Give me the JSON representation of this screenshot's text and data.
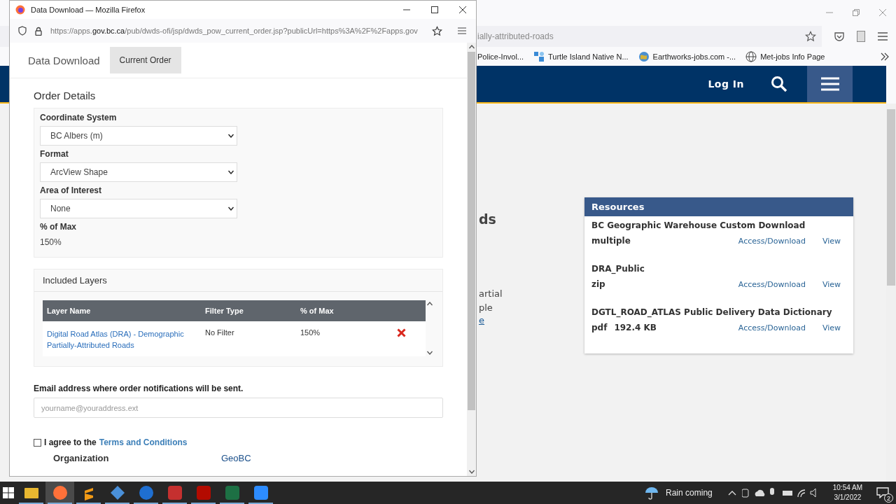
{
  "background_browser": {
    "url_tail": "ially-attributed-roads",
    "bookmarks": [
      {
        "label": "Police-Invol...",
        "kind": "none"
      },
      {
        "label": "Turtle Island Native N...",
        "kind": "site"
      },
      {
        "label": "Earthworks-jobs.com -...",
        "kind": "earth"
      },
      {
        "label": "Met-jobs Info Page",
        "kind": "globe"
      }
    ],
    "header": {
      "login": "Log In"
    },
    "page_fragments": [
      {
        "text": "ds",
        "kind": "heading"
      },
      {
        "text": "artial",
        "kind": "text"
      },
      {
        "text": "ple",
        "kind": "text"
      },
      {
        "text": "e",
        "kind": "link"
      }
    ],
    "resources": {
      "title": "Resources",
      "items": [
        {
          "name": "BC Geographic Warehouse Custom Download",
          "format": "multiple",
          "access": "Access/Download",
          "view": "View"
        },
        {
          "name": "DRA_Public",
          "format": "zip",
          "access": "Access/Download",
          "view": "View"
        },
        {
          "name": "DGTL_ROAD_ATLAS Public Delivery Data Dictionary",
          "format": "pdf",
          "size": "192.4 KB",
          "access": "Access/Download",
          "view": "View"
        }
      ]
    }
  },
  "popup": {
    "title": "Data Download — Mozilla Firefox",
    "url": "https://apps.**gov.bc.ca**/pub/dwds-ofi/jsp/dwds_pow_current_order.jsp?publicUrl=https%3A%2F%2Fapps.gov",
    "nav": {
      "brand": "Data Download",
      "tabs": [
        {
          "label": "Current Order",
          "selected": true
        }
      ]
    },
    "order_details": {
      "title": "Order Details",
      "fields": [
        {
          "label": "Coordinate System",
          "kind": "select",
          "value": "BC Albers (m)"
        },
        {
          "label": "Format",
          "kind": "select",
          "value": "ArcView Shape"
        },
        {
          "label": "Area of Interest",
          "kind": "select",
          "value": "None"
        },
        {
          "label": "% of Max",
          "kind": "text",
          "value": "150%"
        }
      ]
    },
    "included_layers": {
      "title": "Included Layers",
      "columns": [
        "Layer Name",
        "Filter Type",
        "% of Max"
      ],
      "rows": [
        {
          "layer": "Digital Road Atlas (DRA) - Demographic Partially-Attributed Roads",
          "filter": "No Filter",
          "percent": "150%"
        }
      ]
    },
    "email": {
      "label": "Email address where order notifications will be sent.",
      "placeholder": "yourname@youraddress.ext"
    },
    "agree": {
      "checked": false,
      "text": "I agree to the",
      "link": "Terms and Conditions"
    },
    "organization": {
      "label": "Organization",
      "value": "GeoBC"
    }
  },
  "taskbar": {
    "apps": [
      {
        "kind": "files",
        "active": false
      },
      {
        "kind": "firefox",
        "active": true
      },
      {
        "kind": "sublime",
        "active": false
      },
      {
        "kind": "git",
        "active": false
      },
      {
        "kind": "globe",
        "active": false
      },
      {
        "kind": "zotero",
        "active": false
      },
      {
        "kind": "pdf",
        "active": false
      },
      {
        "kind": "excel",
        "active": false
      },
      {
        "kind": "zoom",
        "active": false
      }
    ],
    "weather": "Rain coming",
    "time": "10:54 AM",
    "date": "3/1/2022",
    "notifications": "2"
  }
}
